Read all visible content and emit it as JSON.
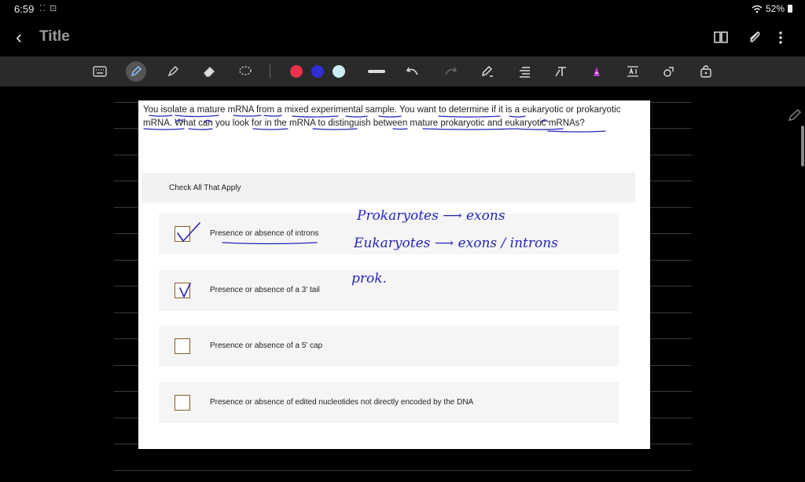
{
  "status": {
    "time": "6:59",
    "indicators": "⁚⁚ ⊡",
    "battery": "52%"
  },
  "header": {
    "back_label": "‹",
    "title": "Title"
  },
  "toolbar": {
    "tools": [
      "keyboard-icon",
      "pen-icon",
      "highlighter-icon",
      "eraser-icon",
      "lasso-icon"
    ],
    "colors": [
      "#e8334a",
      "#2f2fd6",
      "#c7eef2"
    ],
    "actions": [
      "line-icon",
      "undo-icon",
      "redo-icon",
      "pen-settings-icon",
      "text-align-icon",
      "text-icon",
      "shape-a-icon",
      "text-box-icon",
      "shapes-icon",
      "lock-icon"
    ]
  },
  "question": {
    "text": "You isolate a mature mRNA from a mixed experimental sample. You want to determine if it is a eukaryotic or prokaryotic mRNA. What can you look for in the mRNA to distinguish between mature prokaryotic and eukaryotic mRNAs?",
    "instruction": "Check All That Apply",
    "options": [
      {
        "label": "Presence or absence of introns",
        "checked": true
      },
      {
        "label": "Presence or absence of a 3' tail",
        "checked": true
      },
      {
        "label": "Presence or absence of a 5' cap",
        "checked": false
      },
      {
        "label": "Presence or absence of edited nucleotides not directly encoded by the DNA",
        "checked": false
      }
    ]
  },
  "annotations": {
    "line1": "Prokaryotes ⟶ exons",
    "line2": "Eukaryotes ⟶ exons / introns",
    "line3": "prok."
  },
  "ink_color": "#2525b8"
}
